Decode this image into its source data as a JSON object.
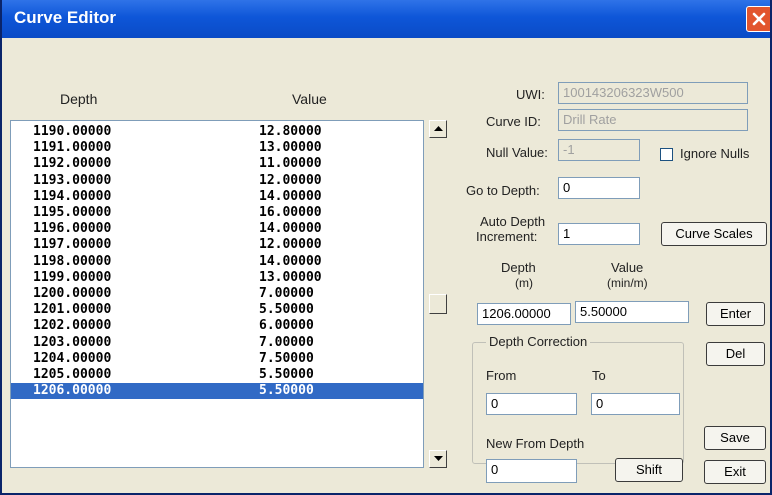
{
  "window": {
    "title": "Curve Editor"
  },
  "list": {
    "columns": {
      "depth": "Depth",
      "value": "Value"
    },
    "rows": [
      {
        "depth": "1190.00000",
        "value": "12.80000"
      },
      {
        "depth": "1191.00000",
        "value": "13.00000"
      },
      {
        "depth": "1192.00000",
        "value": "11.00000"
      },
      {
        "depth": "1193.00000",
        "value": "12.00000"
      },
      {
        "depth": "1194.00000",
        "value": "14.00000"
      },
      {
        "depth": "1195.00000",
        "value": "16.00000"
      },
      {
        "depth": "1196.00000",
        "value": "14.00000"
      },
      {
        "depth": "1197.00000",
        "value": "12.00000"
      },
      {
        "depth": "1198.00000",
        "value": "14.00000"
      },
      {
        "depth": "1199.00000",
        "value": "13.00000"
      },
      {
        "depth": "1200.00000",
        "value": "7.00000"
      },
      {
        "depth": "1201.00000",
        "value": "5.50000"
      },
      {
        "depth": "1202.00000",
        "value": "6.00000"
      },
      {
        "depth": "1203.00000",
        "value": "7.00000"
      },
      {
        "depth": "1204.00000",
        "value": "7.50000"
      },
      {
        "depth": "1205.00000",
        "value": "5.50000"
      },
      {
        "depth": "1206.00000",
        "value": "5.50000",
        "selected": true
      }
    ]
  },
  "form": {
    "uwi": {
      "label": "UWI:",
      "value": "100143206323W500"
    },
    "curve_id": {
      "label": "Curve ID:",
      "value": "Drill Rate"
    },
    "null_value": {
      "label": "Null Value:",
      "value": "-1"
    },
    "ignore_nulls": {
      "label": "Ignore Nulls",
      "checked": false
    },
    "go_to_depth": {
      "label": "Go to Depth:",
      "value": "0"
    },
    "auto_depth": {
      "label_line1": "Auto Depth",
      "label_line2": "Increment:",
      "value": "1"
    },
    "curve_scales_label": "Curve Scales",
    "depth_col": {
      "line1": "Depth",
      "line2": "(m)",
      "value": "1206.00000"
    },
    "value_col": {
      "line1": "Value",
      "line2": "(min/m)",
      "value": "5.50000"
    },
    "enter_label": "Enter",
    "del_label": "Del",
    "depth_correction": {
      "title": "Depth Correction",
      "from_label": "From",
      "to_label": "To",
      "from_value": "0",
      "to_value": "0",
      "new_from_label": "New From Depth",
      "new_from_value": "0",
      "shift_label": "Shift"
    },
    "save_label": "Save",
    "exit_label": "Exit"
  },
  "colors": {
    "titlebar": "#0e56d8",
    "selection": "#316ac5",
    "close": "#e2552e"
  }
}
